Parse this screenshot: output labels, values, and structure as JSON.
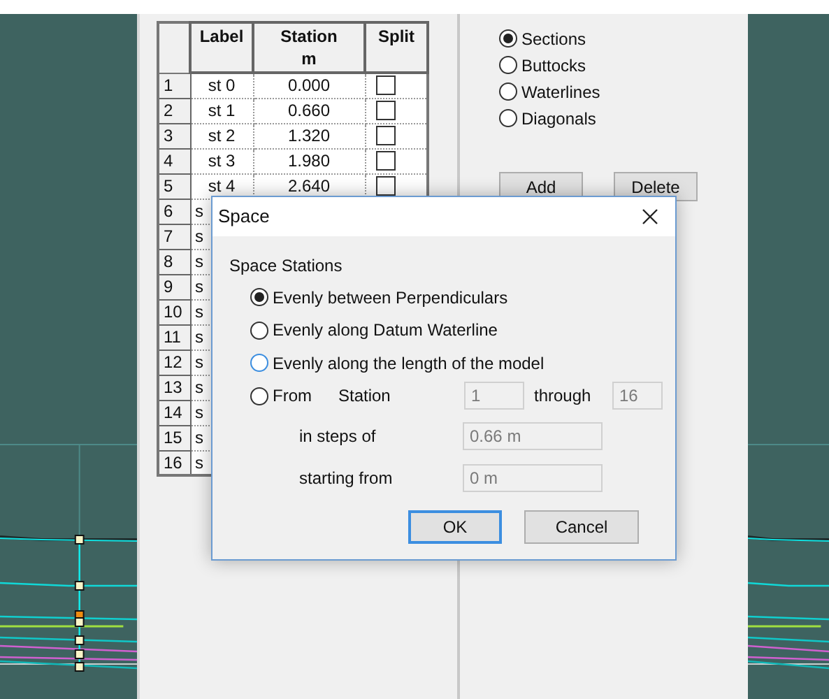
{
  "table": {
    "columns": [
      "Label",
      "Station",
      "Split"
    ],
    "unit": "m",
    "rows": [
      {
        "number": "1",
        "label": "st 0",
        "station": "0.000",
        "split": false
      },
      {
        "number": "2",
        "label": "st 1",
        "station": "0.660",
        "split": false
      },
      {
        "number": "3",
        "label": "st 2",
        "station": "1.320",
        "split": false
      },
      {
        "number": "4",
        "label": "st 3",
        "station": "1.980",
        "split": false
      },
      {
        "number": "5",
        "label": "st 4",
        "station": "2.640",
        "split": false
      },
      {
        "number": "6",
        "label": "s"
      },
      {
        "number": "7",
        "label": "s"
      },
      {
        "number": "8",
        "label": "s"
      },
      {
        "number": "9",
        "label": "s"
      },
      {
        "number": "10",
        "label": "s"
      },
      {
        "number": "11",
        "label": "s"
      },
      {
        "number": "12",
        "label": "s"
      },
      {
        "number": "13",
        "label": "s"
      },
      {
        "number": "14",
        "label": "s"
      },
      {
        "number": "15",
        "label": "s"
      },
      {
        "number": "16",
        "label": "s"
      }
    ]
  },
  "line_types": [
    {
      "label": "Sections",
      "selected": true
    },
    {
      "label": "Buttocks",
      "selected": false
    },
    {
      "label": "Waterlines",
      "selected": false
    },
    {
      "label": "Diagonals",
      "selected": false
    }
  ],
  "buttons": [
    "Add",
    "Delete"
  ],
  "dialog": {
    "title": "Space",
    "group": "Space Stations",
    "options": [
      {
        "label": "Evenly between Perpendiculars",
        "selected": true,
        "hovered": false
      },
      {
        "label": "Evenly along Datum Waterline",
        "selected": false,
        "hovered": false
      },
      {
        "label": "Evenly along the length of the model",
        "selected": false,
        "hovered": true
      },
      {
        "label": "From",
        "selected": false,
        "hovered": false
      }
    ],
    "station_label": "Station",
    "station_from": "1",
    "through_label": "through",
    "station_to": "16",
    "steps_label": "in steps of",
    "steps": "0.66 m",
    "start_label": "starting from",
    "start": "0 m",
    "ok": "OK",
    "cancel": "Cancel"
  }
}
